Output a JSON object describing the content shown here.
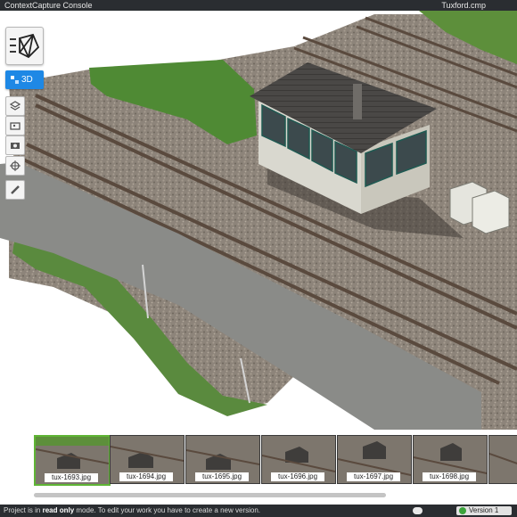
{
  "titlebar": {
    "app_name": "ContextCapture Console",
    "project_file": "Tuxford.cmp"
  },
  "toolbar": {
    "view_mode_label": "3D",
    "tools": [
      {
        "name": "layers-tool",
        "icon": "layers-icon"
      },
      {
        "name": "photos-tool",
        "icon": "photos-icon"
      },
      {
        "name": "camera-tool",
        "icon": "camera-icon"
      },
      {
        "name": "navigate-tool",
        "icon": "move-crosshair-icon"
      },
      {
        "name": "measure-tool",
        "icon": "ruler-pencil-icon"
      }
    ]
  },
  "filmstrip": {
    "photos": [
      "tux-1693.jpg",
      "tux-1694.jpg",
      "tux-1695.jpg",
      "tux-1696.jpg",
      "tux-1697.jpg",
      "tux-1698.jpg"
    ],
    "selected_index": 0
  },
  "statusbar": {
    "message_prefix": "Project is in ",
    "message_bold": "read only",
    "message_suffix": " mode. To edit your work you have to create a new version.",
    "version_label": "Version 1"
  },
  "colors": {
    "accent": "#1e88e5",
    "selected_thumb": "#5fb535",
    "bar_bg": "#2a2d31",
    "version_status": "#3ba33b"
  }
}
